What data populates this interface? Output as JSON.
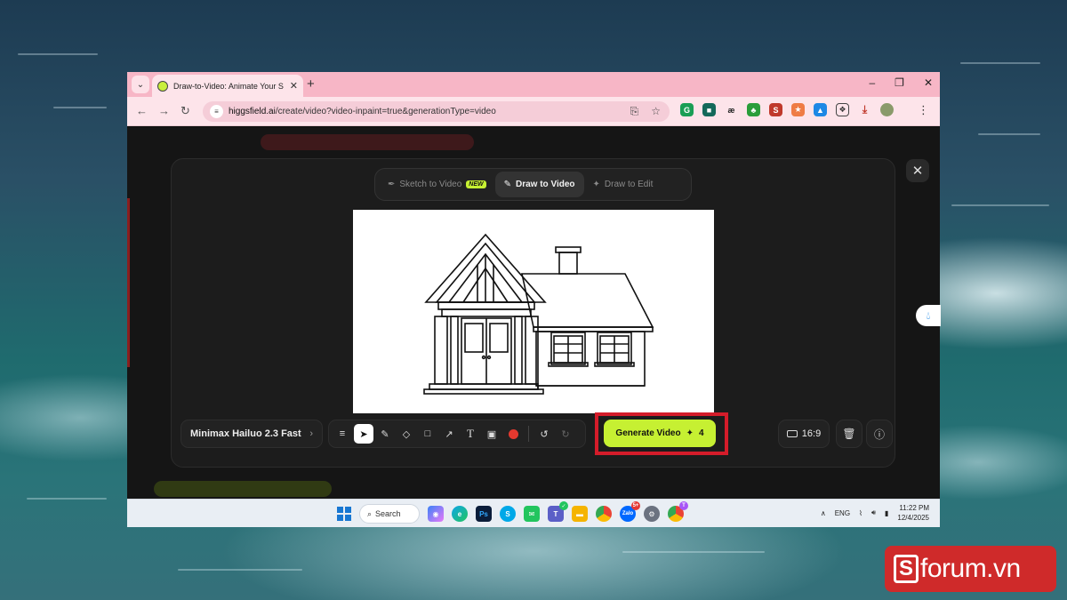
{
  "browser": {
    "tab_title": "Draw-to-Video: Animate Your S",
    "url_host": "higgsfield.ai",
    "url_path": "/create/video?video-inpaint=true&generationType=video"
  },
  "modal": {
    "modes": [
      {
        "label": "Sketch to Video",
        "badge": "NEW"
      },
      {
        "label": "Draw to Video"
      },
      {
        "label": "Draw to Edit"
      }
    ],
    "active_mode": "Draw to Video",
    "model_label": "Minimax Hailuo 2.3 Fast",
    "generate_label": "Generate Video",
    "generate_cost": "4",
    "aspect_ratio": "16:9"
  },
  "taskbar": {
    "search_label": "Search",
    "language": "ENG",
    "time": "11:22 PM",
    "date": "12/4/2025",
    "badge_count": "5+"
  },
  "watermark": {
    "text": "forum.vn",
    "letter": "S"
  },
  "colors": {
    "accent_lime": "#c6f032",
    "highlight_red": "#d41c2a",
    "tab_pink": "#f7b6c6"
  }
}
